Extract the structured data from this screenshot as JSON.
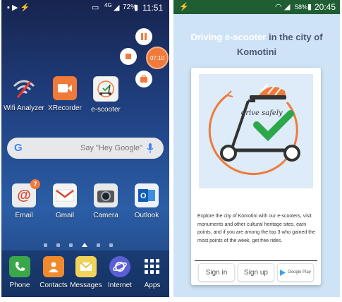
{
  "left_phone": {
    "status_bar": {
      "network": "4G",
      "battery": "72%",
      "time": "11:51"
    },
    "widgets": [
      {
        "label": "Wifi Analyzer",
        "icon": "wifi-analyzer-icon"
      },
      {
        "label": "XRecorder",
        "icon": "xrecorder-icon"
      },
      {
        "label": "e-scooter",
        "icon": "e-scooter-icon"
      }
    ],
    "search": {
      "placeholder": "Say \"Hey Google\""
    },
    "apps": [
      {
        "label": "Email",
        "badge": "7"
      },
      {
        "label": "Gmail"
      },
      {
        "label": "Camera"
      },
      {
        "label": "Outlook"
      }
    ],
    "recorder": {
      "timer": "07:10"
    },
    "dock": [
      {
        "label": "Phone"
      },
      {
        "label": "Contacts"
      },
      {
        "label": "Messages"
      },
      {
        "label": "Internet"
      },
      {
        "label": "Apps"
      }
    ]
  },
  "right_phone": {
    "status_bar": {
      "battery": "58%",
      "time": "20:45"
    },
    "heading": {
      "highlight": "Driving e-scooter",
      "rest": " in the city of Komotini"
    },
    "illustration_text": "drive safely",
    "description": "Explore the city of Komotini with our e-scooters, visit monuments and other cultural heritage sites, earn points, and if you are among the top 3 who gained the most points of the week, get free rides.",
    "buttons": {
      "sign_in": "Sign in",
      "sign_up": "Sign up",
      "store": "Google Play"
    },
    "colors": {
      "accent": "#f07a3a",
      "check": "#2aa84a",
      "background": "#cfe3f7"
    }
  }
}
